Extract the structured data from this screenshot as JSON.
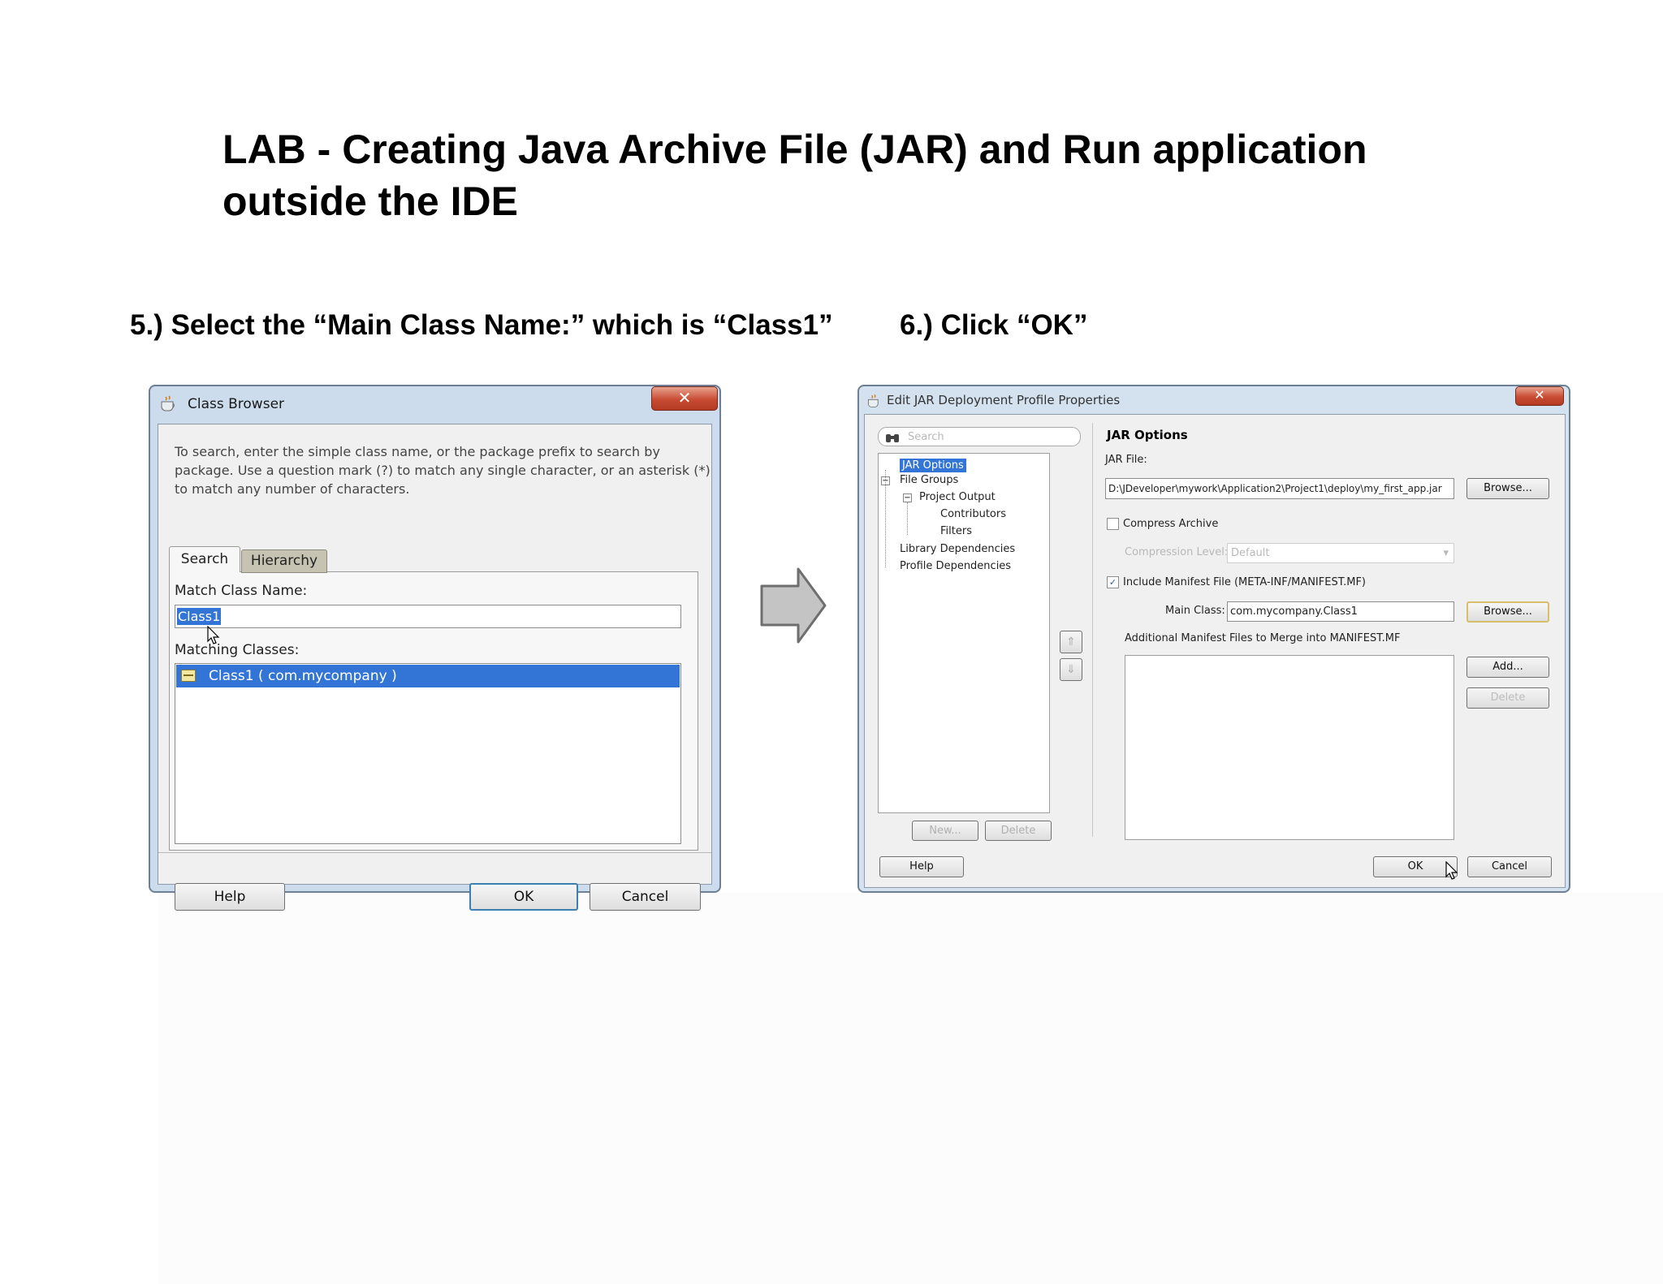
{
  "slide": {
    "title_line1": "LAB - Creating Java Archive File (JAR) and Run application",
    "title_line2": "outside the IDE",
    "step5": "5.) Select the “Main Class Name:” which is “Class1”",
    "step6": "6.) Click “OK”"
  },
  "class_browser": {
    "title": "Class Browser",
    "close": "✕",
    "instructions": [
      "To search, enter the simple class name, or the package prefix to search by",
      "package. Use a question mark (?) to match any single character, or an asterisk (*)",
      "to match any number of characters."
    ],
    "tabs": [
      "Search",
      "Hierarchy"
    ],
    "match_label": "Match Class Name:",
    "match_value": "Class1",
    "matching_label": "Matching Classes:",
    "results": [
      "Class1 ( com.mycompany )"
    ],
    "help": "Help",
    "ok": "OK",
    "cancel": "Cancel"
  },
  "arrow_icon": "right-arrow-icon",
  "jar_dialog": {
    "title": "Edit JAR Deployment Profile Properties",
    "close": "✕",
    "search_placeholder": "Search",
    "tree": {
      "jar_options": "JAR Options",
      "file_groups": "File Groups",
      "project_output": "Project Output",
      "contributors": "Contributors",
      "filters": "Filters",
      "library_dependencies": "Library Dependencies",
      "profile_dependencies": "Profile Dependencies"
    },
    "tree_new": "New...",
    "tree_delete": "Delete",
    "section_title": "JAR Options",
    "jar_file_label": "JAR File:",
    "jar_file_value": "D:\\JDeveloper\\mywork\\Application2\\Project1\\deploy\\my_first_app.jar",
    "browse": "Browse...",
    "compress_label": "Compress Archive",
    "compression_level_label": "Compression Level:",
    "compression_level_value": "Default",
    "include_manifest_label": "Include Manifest File (META-INF/MANIFEST.MF)",
    "main_class_label": "Main Class:",
    "main_class_value": "com.mycompany.Class1",
    "browse2": "Browse...",
    "additional_label": "Additional Manifest Files to Merge into MANIFEST.MF",
    "add": "Add...",
    "delete": "Delete",
    "help": "Help",
    "ok": "OK",
    "cancel": "Cancel"
  }
}
